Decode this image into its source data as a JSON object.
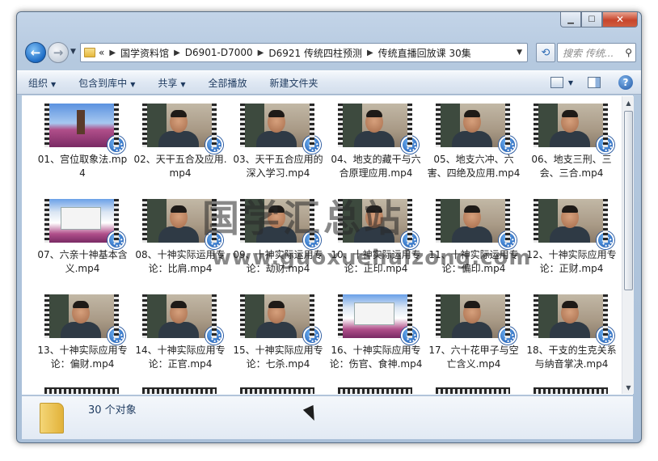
{
  "window": {
    "caption_buttons": [
      "minimize-icon",
      "maximize-icon",
      "close-icon"
    ]
  },
  "address": {
    "overflow": "«",
    "segments": [
      "国学资料馆",
      "D6901-D7000",
      "D6921 传统四柱预测",
      "传统直播回放课 30集"
    ],
    "search_placeholder": "搜索 传统..."
  },
  "commands": {
    "organize": "组织",
    "include_in_library": "包含到库中",
    "share": "共享",
    "play_all": "全部播放",
    "new_folder": "新建文件夹"
  },
  "files": [
    {
      "name": "01、宫位取象法.mp4",
      "thumb": "field"
    },
    {
      "name": "02、天干五合及应用.mp4",
      "thumb": "person"
    },
    {
      "name": "03、天干五合应用的深入学习.mp4",
      "thumb": "person"
    },
    {
      "name": "04、地支的藏干与六合原理应用.mp4",
      "thumb": "person"
    },
    {
      "name": "05、地支六冲、六害、四绝及应用.mp4",
      "thumb": "person"
    },
    {
      "name": "06、地支三刑、三会、三合.mp4",
      "thumb": "person"
    },
    {
      "name": "07、六亲十神基本含义.mp4",
      "thumb": "screen"
    },
    {
      "name": "08、十神实际运用专论：比肩.mp4",
      "thumb": "person"
    },
    {
      "name": "09、十神实际运用专论：劫财.mp4",
      "thumb": "person"
    },
    {
      "name": "10、十神实际运用专论：正印.mp4",
      "thumb": "person"
    },
    {
      "name": "11、十神实际运用专论：偏印.mp4",
      "thumb": "person"
    },
    {
      "name": "12、十神实际应用专论：正财.mp4",
      "thumb": "person"
    },
    {
      "name": "13、十神实际应用专论：偏财.mp4",
      "thumb": "person"
    },
    {
      "name": "14、十神实际应用专论：正官.mp4",
      "thumb": "person"
    },
    {
      "name": "15、十神实际应用专论：七杀.mp4",
      "thumb": "person"
    },
    {
      "name": "16、十神实际应用专论：伤官、食神.mp4",
      "thumb": "screen"
    },
    {
      "name": "17、六十花甲子与空亡含义.mp4",
      "thumb": "person"
    },
    {
      "name": "18、干支的生克关系与纳音掌决.mp4",
      "thumb": "person"
    }
  ],
  "watermark": {
    "title": "国学汇总站",
    "url": "www.guoxuehuizong.com"
  },
  "details": {
    "count": "30 个对象"
  }
}
